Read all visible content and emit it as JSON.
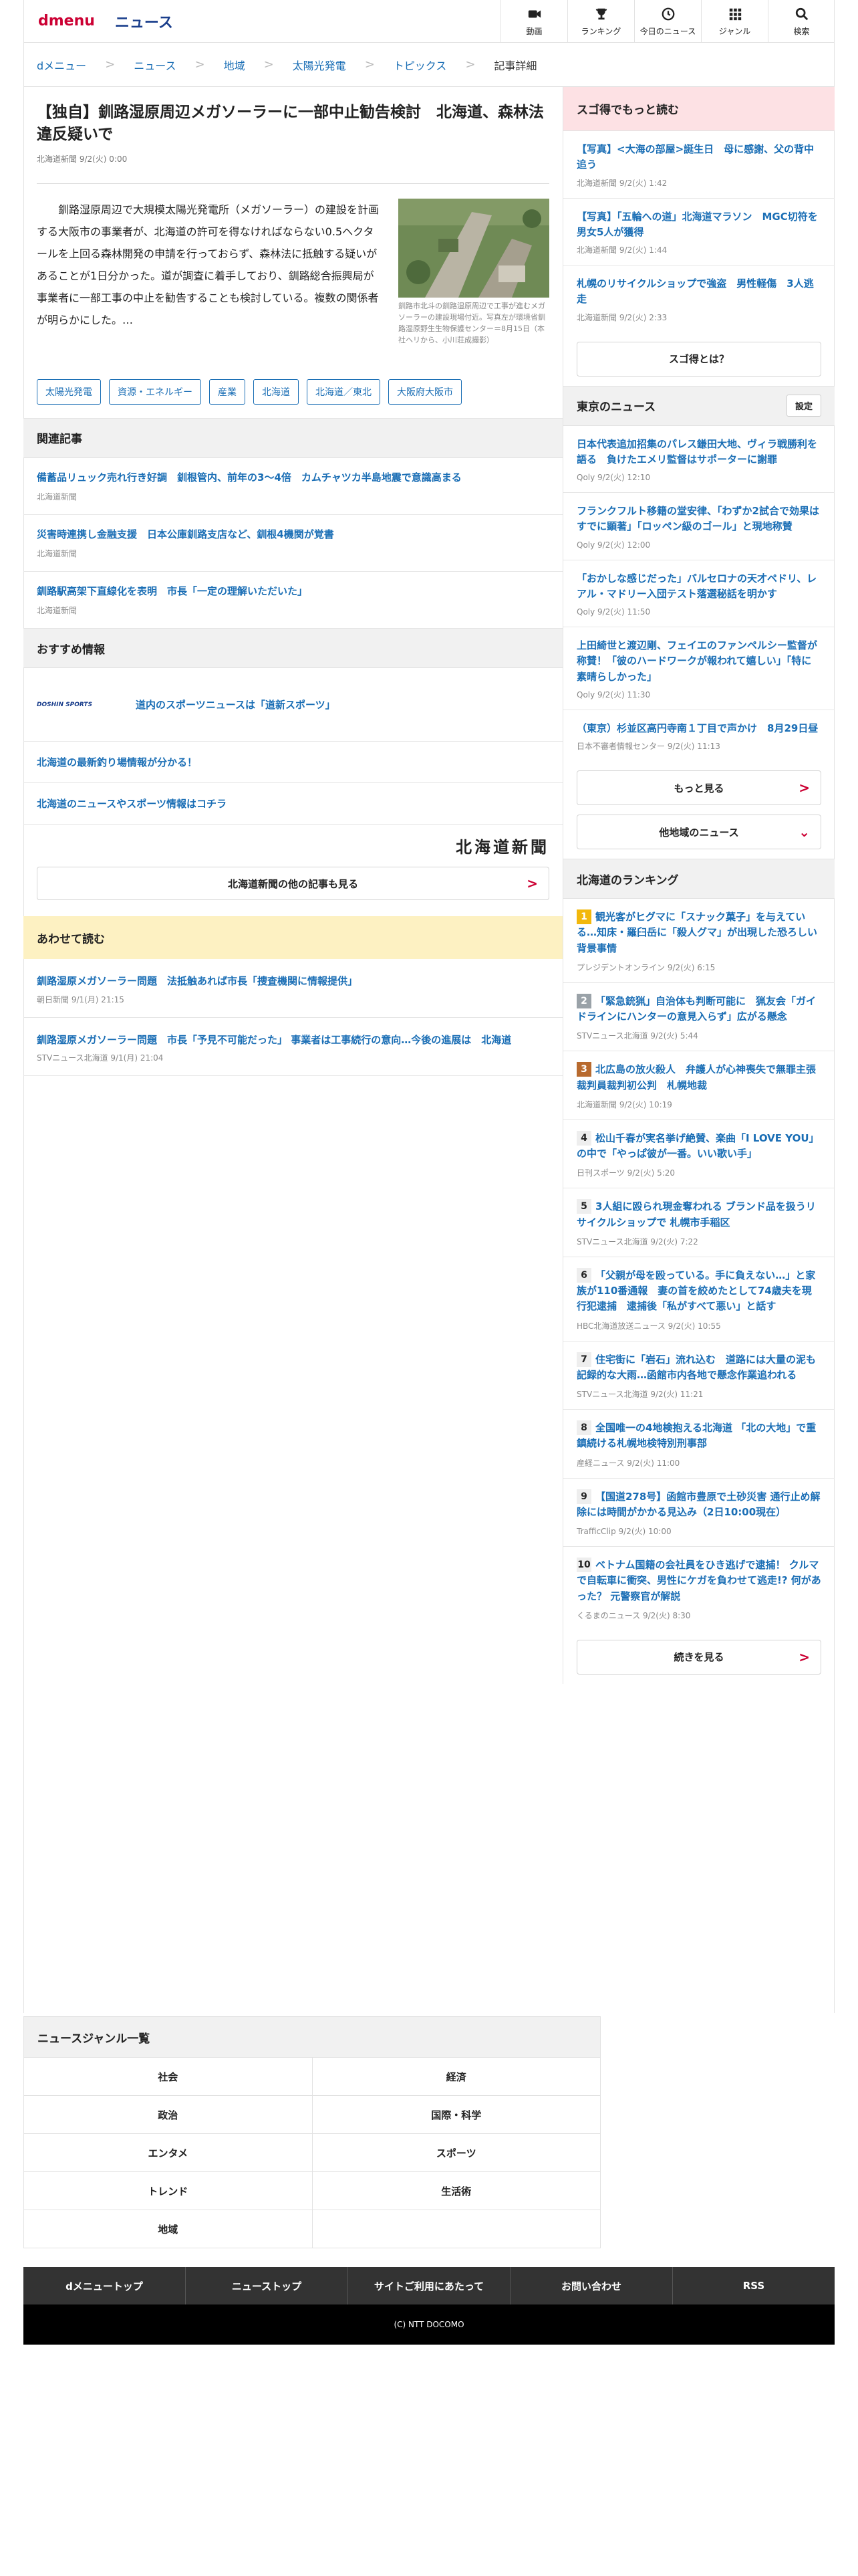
{
  "header": {
    "logo_brand": "d",
    "logo_rest": "menu",
    "section": "ニュース",
    "nav": [
      {
        "label": "動画",
        "icon": "video-icon"
      },
      {
        "label": "ランキング",
        "icon": "trophy-icon"
      },
      {
        "label": "今日のニュース",
        "icon": "clock-icon"
      },
      {
        "label": "ジャンル",
        "icon": "grid-icon"
      },
      {
        "label": "検索",
        "icon": "search-icon"
      }
    ]
  },
  "breadcrumb": [
    "dメニュー",
    "ニュース",
    "地域",
    "太陽光発電",
    "トピックス",
    "記事詳細"
  ],
  "article": {
    "title": "【独自】釧路湿原周辺メガソーラーに一部中止勧告検討　北海道、森林法違反疑いで",
    "meta": "北海道新聞 9/2(火) 0:00",
    "body": "釧路湿原周辺で大規模太陽光発電所（メガソーラー）の建設を計画する大阪市の事業者が、北海道の許可を得なければならない0.5ヘクタールを上回る森林開発の申請を行っておらず、森林法に抵触する疑いがあることが1日分かった。道が調査に着手しており、釧路総合振興局が事業者に一部工事の中止を勧告することも検討している。複数の関係者が明らかにした。…",
    "caption": "釧路市北斗の釧路湿原周辺で工事が進むメガソーラーの建設現場付近。写真左が環境省釧路湿原野生生物保護センター＝8月15日（本社ヘリから、小川荘成撮影）",
    "tags": [
      "太陽光発電",
      "資源・エネルギー",
      "産業",
      "北海道",
      "北海道／東北",
      "大阪府大阪市"
    ]
  },
  "related": {
    "heading": "関連記事",
    "items": [
      {
        "title": "備蓄品リュック売れ行き好調　釧根管内、前年の3～4倍　カムチャツカ半島地震で意識高まる",
        "source": "北海道新聞"
      },
      {
        "title": "災害時連携し金融支援　日本公庫釧路支店など、釧根4機関が覚書",
        "source": "北海道新聞"
      },
      {
        "title": "釧路駅高架下直線化を表明　市長「一定の理解いただいた」",
        "source": "北海道新聞"
      }
    ]
  },
  "recommend": {
    "heading": "おすすめ情報",
    "logo_text": "DOSHIN SPORTS",
    "items": [
      "道内のスポーツニュースは「道新スポーツ」",
      "北海道の最新釣り場情報が分かる！",
      "北海道のニュースやスポーツ情報はコチラ"
    ],
    "publisher": "北海道新聞",
    "more_button": "北海道新聞の他の記事も見る"
  },
  "also_read": {
    "heading": "あわせて読む",
    "items": [
      {
        "title": "釧路湿原メガソーラー問題　法抵触あれば市長「捜査機関に情報提供」",
        "source": "朝日新聞 9/1(月) 21:15"
      },
      {
        "title": "釧路湿原メガソーラー問題　市長「予見不可能だった」 事業者は工事続行の意向…今後の進展は　北海道",
        "source": "STVニュース北海道 9/1(月) 21:04"
      }
    ]
  },
  "sidebar": {
    "picks_heading": "スゴ得でもっと読む",
    "picks": [
      {
        "title": "【写真】<大海の部屋>誕生日　母に感謝、父の背中追う",
        "source": "北海道新聞 9/2(火) 1:42"
      },
      {
        "title": "【写真】「五輪への道」北海道マラソン　MGC切符を男女5人が獲得",
        "source": "北海道新聞 9/2(火) 1:44"
      },
      {
        "title": "札幌のリサイクルショップで強盗　男性軽傷　3人逃走",
        "source": "北海道新聞 9/2(火) 2:33"
      }
    ],
    "picks_button": "スゴ得とは？",
    "tokyo_heading": "東京のニュース",
    "settings_label": "設定",
    "tokyo": [
      {
        "title": "日本代表追加招集のパレス鎌田大地、ヴィラ戦勝利を語る　負けたエメリ監督はサポーターに謝罪",
        "source": "Qoly 9/2(火) 12:10"
      },
      {
        "title": "フランクフルト移籍の堂安律、「わずか2試合で効果はすでに顕著」「ロッペン級のゴール」と現地称賛",
        "source": "Qoly 9/2(火) 12:00"
      },
      {
        "title": "「おかしな感じだった」バルセロナの天才ペドリ、レアル・マドリー入団テスト落選秘話を明かす",
        "source": "Qoly 9/2(火) 11:50"
      },
      {
        "title": "上田綺世と渡辺剛、フェイエのファンペルシー監督が称賛！「彼のハードワークが報われて嬉しい」「特に素晴らしかった」",
        "source": "Qoly 9/2(火) 11:30"
      },
      {
        "title": "（東京）杉並区高円寺南１丁目で声かけ　8月29日昼",
        "source": "日本不審者情報センター 9/2(火) 11:13"
      }
    ],
    "tokyo_more": "もっと見る",
    "other_news": "他地域のニュース",
    "ranking_heading": "北海道のランキング",
    "ranking": [
      {
        "no": "1",
        "title": "観光客がヒグマに「スナック菓子」を与えている…知床・羅臼岳に「殺人グマ」が出現した恐ろしい背景事情",
        "source": "プレジデントオンライン 9/2(火) 6:15"
      },
      {
        "no": "2",
        "title": "「緊急銃猟」自治体も判断可能に　猟友会「ガイドラインにハンターの意見入らず」広がる懸念",
        "source": "STVニュース北海道 9/2(火) 5:44"
      },
      {
        "no": "3",
        "title": "北広島の放火殺人　弁護人が心神喪失で無罪主張　裁判員裁判初公判　札幌地裁",
        "source": "北海道新聞 9/2(火) 10:19"
      },
      {
        "no": "4",
        "title": "松山千春が実名挙げ絶賛、楽曲「I LOVE YOU」の中で「やっぱ彼が一番。いい歌い手」",
        "source": "日刊スポーツ 9/2(火) 5:20"
      },
      {
        "no": "5",
        "title": "3人組に殴られ現金奪われる ブランド品を扱うリサイクルショップで 札幌市手稲区",
        "source": "STVニュース北海道 9/2(火) 7:22"
      },
      {
        "no": "6",
        "title": "「父親が母を殴っている。手に負えない…」と家族が110番通報　妻の首を絞めたとして74歳夫を現行犯逮捕　逮捕後「私がすべて悪い」と話す",
        "source": "HBC北海道放送ニュース 9/2(火) 10:55"
      },
      {
        "no": "7",
        "title": "住宅街に「岩石」流れ込む　道路には大量の泥も　記録的な大雨…函館市内各地で懸念作業追われる",
        "source": "STVニュース北海道 9/2(火) 11:21"
      },
      {
        "no": "8",
        "title": "全国唯一の4地検抱える北海道 「北の大地」で重鎮続ける札幌地検特別刑事部",
        "source": "産経ニュース 9/2(火) 11:00"
      },
      {
        "no": "9",
        "title": "【国道278号】函館市豊原で土砂災害 通行止め解除には時間がかかる見込み（2日10:00現在）",
        "source": "TrafficClip 9/2(火) 10:00"
      },
      {
        "no": "10",
        "title": "ベトナム国籍の会社員をひき逃げで逮捕！ クルマで自転車に衝突、男性にケガを負わせて逃走!? 何があった？ 元警察官が解説",
        "source": "くるまのニュース 9/2(火) 8:30"
      }
    ],
    "ranking_more": "続きを見る"
  },
  "genres": {
    "heading": "ニュースジャンル一覧",
    "items": [
      "社会",
      "経済",
      "政治",
      "国際・科学",
      "エンタメ",
      "スポーツ",
      "トレンド",
      "生活術",
      "地域",
      ""
    ]
  },
  "footer": {
    "links": [
      "dメニュートップ",
      "ニューストップ",
      "サイトご利用にあたって",
      "お問い合わせ",
      "RSS"
    ],
    "copyright": "(C) NTT DOCOMO"
  }
}
